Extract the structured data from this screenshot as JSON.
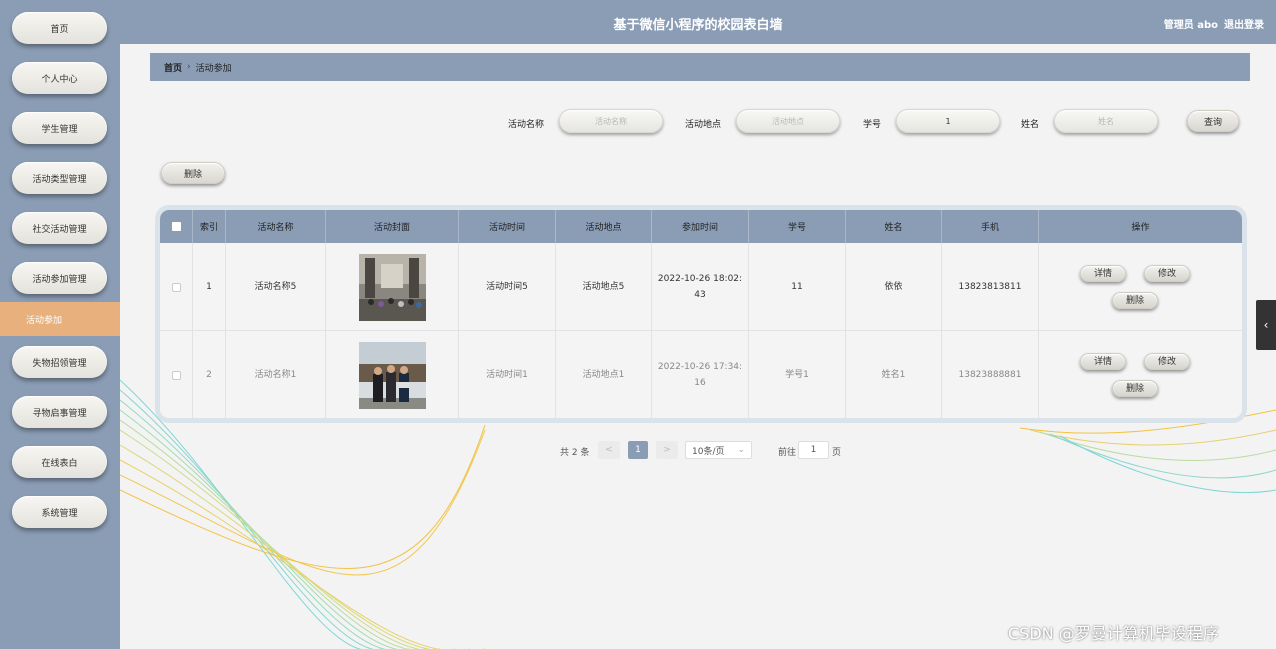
{
  "sidebar": {
    "items": [
      {
        "label": "首页"
      },
      {
        "label": "个人中心"
      },
      {
        "label": "学生管理"
      },
      {
        "label": "活动类型管理"
      },
      {
        "label": "社交活动管理"
      },
      {
        "label": "活动参加管理"
      },
      {
        "label": "失物招领管理"
      },
      {
        "label": "寻物启事管理"
      },
      {
        "label": "在线表白"
      },
      {
        "label": "系统管理"
      }
    ],
    "active_label": "活动参加"
  },
  "header": {
    "title": "基于微信小程序的校园表白墙",
    "user": "管理员 abo",
    "logout": "退出登录"
  },
  "breadcrumb": {
    "home": "首页",
    "separator": "›",
    "current": "活动参加"
  },
  "search": {
    "activity_name_label": "活动名称",
    "activity_name_placeholder": "活动名称",
    "activity_place_label": "活动地点",
    "activity_place_placeholder": "活动地点",
    "student_id_label": "学号",
    "student_id_value": "1",
    "name_label": "姓名",
    "name_placeholder": "姓名",
    "query_button": "查询"
  },
  "toolbar": {
    "delete_button": "删除"
  },
  "table": {
    "columns": [
      "索引",
      "活动名称",
      "活动封面",
      "活动时间",
      "活动地点",
      "参加时间",
      "学号",
      "姓名",
      "手机",
      "操作"
    ],
    "rows": [
      {
        "index": "1",
        "activity_name": "活动名称5",
        "cover_image": "crowd-photo",
        "activity_time": "活动时间5",
        "activity_place": "活动地点5",
        "join_time_line1": "2022-10-26 18:02:",
        "join_time_line2": "43",
        "student_id": "11",
        "name": "依依",
        "phone": "13823813811",
        "detail": "详情",
        "edit": "修改",
        "delete": "删除"
      },
      {
        "index": "2",
        "activity_name": "活动名称1",
        "cover_image": "group-photo",
        "activity_time": "活动时间1",
        "activity_place": "活动地点1",
        "join_time_line1": "2022-10-26 17:34:",
        "join_time_line2": "16",
        "student_id": "学号1",
        "name": "姓名1",
        "phone": "13823888881",
        "detail": "详情",
        "edit": "修改",
        "delete": "删除"
      }
    ]
  },
  "pagination": {
    "total": "共 2 条",
    "prev": "<",
    "current_page": "1",
    "next": ">",
    "page_size": "10条/页",
    "goto_label": "前往",
    "goto_value": "1",
    "page_unit": "页"
  },
  "watermark": "CSDN @罗曼计算机毕设程序",
  "colors": {
    "sidebar": "#8a9db5",
    "active_item": "#e8b07c",
    "page_active": "#8a9db5"
  }
}
